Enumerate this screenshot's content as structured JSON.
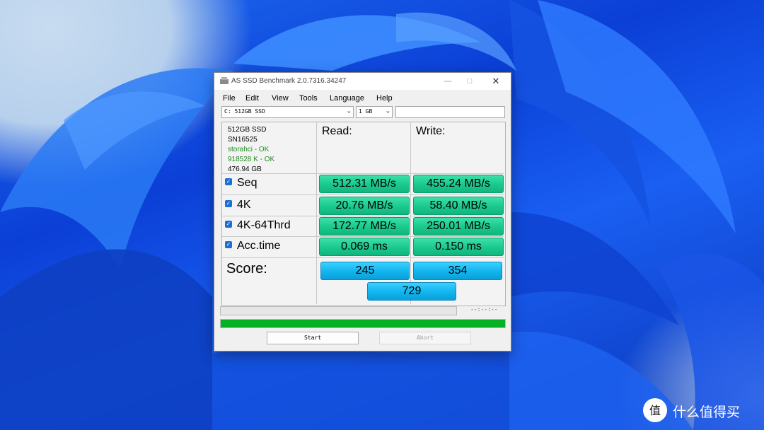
{
  "window": {
    "title": "AS SSD Benchmark 2.0.7316.34247"
  },
  "menu": [
    "File",
    "Edit",
    "View",
    "Tools",
    "Language",
    "Help"
  ],
  "drive_select": {
    "value": "C: 512GB SSD"
  },
  "size_select": {
    "value": "1 GB"
  },
  "info": {
    "name": "512GB SSD",
    "firmware": "SN16525",
    "driver": "storahci - OK",
    "alignment": "918528 K - OK",
    "capacity": "476.94 GB"
  },
  "columns": {
    "read": "Read:",
    "write": "Write:"
  },
  "rows": [
    {
      "label": "Seq",
      "read": "512.31 MB/s",
      "write": "455.24 MB/s",
      "checked": true
    },
    {
      "label": "4K",
      "read": "20.76 MB/s",
      "write": "58.40 MB/s",
      "checked": true
    },
    {
      "label": "4K-64Thrd",
      "read": "172.77 MB/s",
      "write": "250.01 MB/s",
      "checked": true
    },
    {
      "label": "Acc.time",
      "read": "0.069 ms",
      "write": "0.150 ms",
      "checked": true
    }
  ],
  "score": {
    "label": "Score:",
    "read": "245",
    "write": "354",
    "total": "729"
  },
  "progress": {
    "time": "--:--:--",
    "bar_fill_fraction": 0.0,
    "green_fill_fraction": 1.0
  },
  "buttons": {
    "start": "Start",
    "abort": "Abort"
  },
  "watermark": {
    "text": "什么值得买",
    "logo": "值"
  },
  "colors": {
    "value_green": "#19c98d",
    "score_blue": "#12b4ee",
    "progress_green": "#06b025",
    "checkbox_blue": "#1a6fd4"
  }
}
